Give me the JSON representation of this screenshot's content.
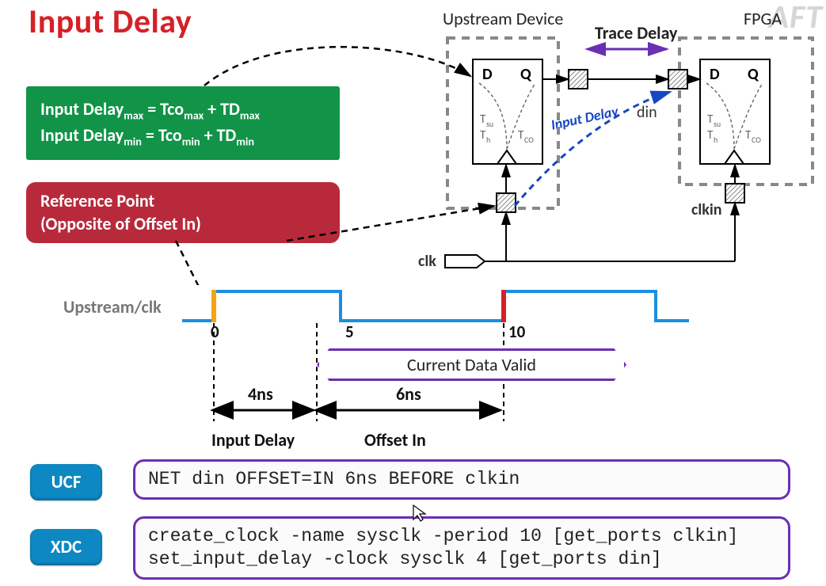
{
  "title": "Input Delay",
  "watermark": "AFT",
  "labels": {
    "upstream_device": "Upstream Device",
    "trace_delay": "Trace Delay",
    "fpga": "FPGA",
    "din": "din",
    "clkin": "clkin",
    "clk": "clk",
    "input_delay_arrow": "Input Delay",
    "upstream_clk": "Upstream/clk",
    "tick0": "0",
    "tick5": "5",
    "tick10": "10",
    "data_valid": "Current Data Valid",
    "four_ns": "4ns",
    "six_ns": "6ns",
    "input_delay_section": "Input Delay",
    "offset_in_section": "Offset In",
    "ucf": "UCF",
    "xdc": "XDC"
  },
  "formula": {
    "line1_html": "Input Delay<sub>max</sub> = Tco<sub>max</sub> + TD<sub>max</sub>",
    "line2_html": "Input Delay<sub>min</sub> = Tco<sub>min</sub> + TD<sub>min</sub>"
  },
  "reference": {
    "line1": "Reference Point",
    "line2": "(Opposite of Offset In)"
  },
  "ff_internal": {
    "D": "D",
    "Q": "Q",
    "Tsu": "T",
    "Tsu_sub": "su",
    "Th": "T",
    "Th_sub": "h",
    "Tco": "T",
    "Tco_sub": "CO"
  },
  "ucf_code": "NET din OFFSET=IN 6ns BEFORE clkin",
  "xdc_code": "create_clock -name sysclk -period 10 [get_ports clkin]\nset_input_delay -clock sysclk 4 [get_ports din]"
}
